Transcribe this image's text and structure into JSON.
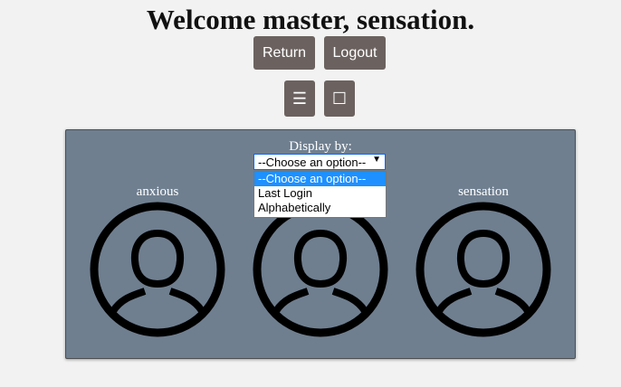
{
  "header": {
    "title": "Welcome master, sensation."
  },
  "toolbar": {
    "return_label": "Return",
    "logout_label": "Logout",
    "menu_glyph": "☰",
    "square_glyph": "☐"
  },
  "panel": {
    "display_by_label": "Display by:",
    "select": {
      "selected": "--Choose an option--",
      "options": [
        "--Choose an option--",
        "Last Login",
        "Alphabetically"
      ]
    },
    "users": [
      {
        "name": "anxious",
        "icon": "user-avatar-icon"
      },
      {
        "name": "",
        "icon": "user-avatar-icon"
      },
      {
        "name": "sensation",
        "icon": "user-avatar-icon"
      }
    ]
  },
  "colors": {
    "page_bg": "#f2f2f2",
    "button_bg": "#6b625f",
    "panel_bg": "#6f7f90",
    "option_highlight": "#1e90ff"
  }
}
